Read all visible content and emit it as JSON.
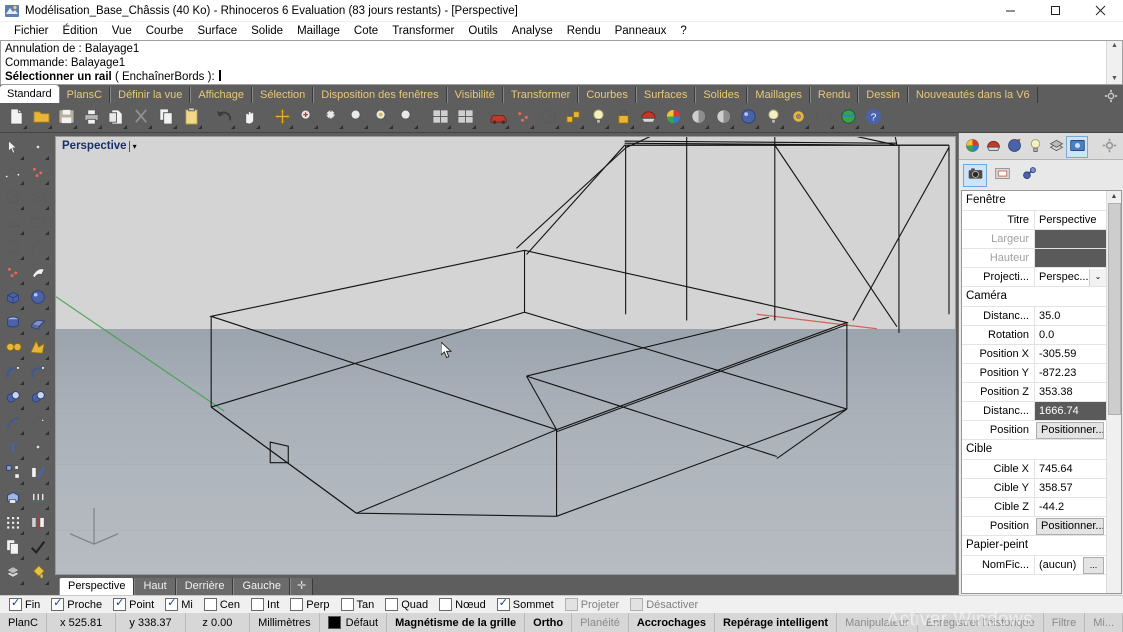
{
  "window": {
    "title": "Modélisation_Base_Châssis (40 Ko) - Rhinoceros 6 Evaluation (83 jours restants) - [Perspective]",
    "app_icon": "rhino-icon",
    "minimize": "—",
    "maximize": "▢",
    "close": "✕"
  },
  "menubar": [
    {
      "label": "Fichier",
      "name": "menu-fichier"
    },
    {
      "label": "Édition",
      "name": "menu-edition"
    },
    {
      "label": "Vue",
      "name": "menu-vue"
    },
    {
      "label": "Courbe",
      "name": "menu-courbe"
    },
    {
      "label": "Surface",
      "name": "menu-surface"
    },
    {
      "label": "Solide",
      "name": "menu-solide"
    },
    {
      "label": "Maillage",
      "name": "menu-maillage"
    },
    {
      "label": "Cote",
      "name": "menu-cote"
    },
    {
      "label": "Transformer",
      "name": "menu-transformer"
    },
    {
      "label": "Outils",
      "name": "menu-outils"
    },
    {
      "label": "Analyse",
      "name": "menu-analyse"
    },
    {
      "label": "Rendu",
      "name": "menu-rendu"
    },
    {
      "label": "Panneaux",
      "name": "menu-panneaux"
    },
    {
      "label": "?",
      "name": "menu-aide"
    }
  ],
  "command_area": {
    "history_line_1": "Annulation de : Balayage1",
    "history_line_2": "Commande: Balayage1",
    "prompt_bold": "Sélectionner un rail",
    "prompt_option": "( EnchaînerBords ):",
    "input_value": ""
  },
  "toolbar_tabs": [
    {
      "label": "Standard",
      "active": true
    },
    {
      "label": "PlansC",
      "active": false
    },
    {
      "label": "Définir la vue",
      "active": false
    },
    {
      "label": "Affichage",
      "active": false
    },
    {
      "label": "Sélection",
      "active": false
    },
    {
      "label": "Disposition des fenêtres",
      "active": false
    },
    {
      "label": "Visibilité",
      "active": false
    },
    {
      "label": "Transformer",
      "active": false
    },
    {
      "label": "Courbes",
      "active": false
    },
    {
      "label": "Surfaces",
      "active": false
    },
    {
      "label": "Solides",
      "active": false
    },
    {
      "label": "Maillages",
      "active": false
    },
    {
      "label": "Rendu",
      "active": false
    },
    {
      "label": "Dessin",
      "active": false
    },
    {
      "label": "Nouveautés dans la V6",
      "active": false
    }
  ],
  "toolbar_tabs_gear": "gear-icon",
  "main_toolbar": [
    {
      "icon": "new-file-icon"
    },
    {
      "icon": "open-folder-icon"
    },
    {
      "icon": "save-icon"
    },
    {
      "icon": "print-icon"
    },
    {
      "icon": "cut-icon"
    },
    {
      "icon": "scissors-icon"
    },
    {
      "icon": "copy-icon"
    },
    {
      "icon": "paste-icon"
    },
    {
      "icon": "undo-icon"
    },
    {
      "icon": "pan-hand-icon"
    },
    {
      "icon": "move-icon"
    },
    {
      "icon": "zoom-in-icon"
    },
    {
      "icon": "zoom-window-icon"
    },
    {
      "icon": "zoom-extents-icon"
    },
    {
      "icon": "zoom-selected-icon"
    },
    {
      "icon": "zoom-previous-icon"
    },
    {
      "icon": "viewport-4-icon"
    },
    {
      "icon": "viewport-layout-icon"
    },
    {
      "icon": "car-icon"
    },
    {
      "icon": "points-icon"
    },
    {
      "icon": "circle-point-icon"
    },
    {
      "icon": "blocks-icon"
    },
    {
      "icon": "light-bulb-icon"
    },
    {
      "icon": "lock-icon"
    },
    {
      "icon": "materials-icon"
    },
    {
      "icon": "color-wheel-icon"
    },
    {
      "icon": "shade-sphere-icon"
    },
    {
      "icon": "render-sphere-icon"
    },
    {
      "icon": "blue-sphere-icon"
    },
    {
      "icon": "spotlight-icon"
    },
    {
      "icon": "gear-orange-icon"
    },
    {
      "icon": "dimension-icon"
    },
    {
      "icon": "earth-icon"
    },
    {
      "icon": "help-icon"
    }
  ],
  "left_toolbar": [
    {
      "icon": "select-arrow-icon"
    },
    {
      "icon": "point-icon"
    },
    {
      "icon": "polyline-icon"
    },
    {
      "icon": "curve-control-points-icon"
    },
    {
      "icon": "circle-icon"
    },
    {
      "icon": "ellipse-icon"
    },
    {
      "icon": "arc-icon"
    },
    {
      "icon": "rectangle-icon"
    },
    {
      "icon": "polygon-icon"
    },
    {
      "icon": "free-curve-icon"
    },
    {
      "icon": "surface-control-points-icon"
    },
    {
      "icon": "revolve-surface-icon"
    },
    {
      "icon": "box-icon"
    },
    {
      "icon": "sphere-icon"
    },
    {
      "icon": "cylinder-icon"
    },
    {
      "icon": "extrude-surface-icon"
    },
    {
      "icon": "boolean-union-icon"
    },
    {
      "icon": "boolean-split-icon"
    },
    {
      "icon": "fillet-edge-icon"
    },
    {
      "icon": "chamfer-edge-icon"
    },
    {
      "icon": "boolean-difference-icon"
    },
    {
      "icon": "boolean-intersection-icon"
    },
    {
      "icon": "offset-curve-icon"
    },
    {
      "icon": "blend-curve-icon"
    },
    {
      "icon": "text-icon"
    },
    {
      "icon": "point-editing-icon"
    },
    {
      "icon": "explode-icon"
    },
    {
      "icon": "trim-icon"
    },
    {
      "icon": "cap-planar-icon"
    },
    {
      "icon": "array-linear-icon"
    },
    {
      "icon": "array-grid-icon"
    },
    {
      "icon": "mirror-icon"
    },
    {
      "icon": "copy-object-icon"
    },
    {
      "icon": "check-icon"
    },
    {
      "icon": "layers-icon"
    },
    {
      "icon": "paint-bucket-icon"
    }
  ],
  "viewport": {
    "title": "Perspective",
    "dropdown_arrow": "▾",
    "cursor_label": "mouse-pointer",
    "sky_color": "#d4d4d4",
    "ground_color": "#a8afb8",
    "wire_color": "#000000",
    "x_axis_color": "#c94b3a",
    "y_axis_color": "#3fa24a",
    "tabs": [
      {
        "label": "Perspective",
        "active": true
      },
      {
        "label": "Haut",
        "active": false
      },
      {
        "label": "Derrière",
        "active": false
      },
      {
        "label": "Gauche",
        "active": false
      }
    ],
    "tab_add": "✛"
  },
  "right_panel": {
    "panel_icons": [
      {
        "icon": "properties-icon",
        "selected": false
      },
      {
        "icon": "materials-icon",
        "selected": false
      },
      {
        "icon": "render-icon",
        "selected": false
      },
      {
        "icon": "light-icon",
        "selected": false
      },
      {
        "icon": "layers-folder-icon",
        "selected": false
      },
      {
        "icon": "display-icon",
        "selected": true
      },
      {
        "icon": "gear-icon",
        "selected": false
      }
    ],
    "sub_icons": [
      {
        "icon": "camera-icon",
        "selected": true
      },
      {
        "icon": "viewport-frame-icon",
        "selected": false
      },
      {
        "icon": "object-props-icon",
        "selected": false
      }
    ],
    "sections": [
      {
        "name": "Fenêtre",
        "title": "Fenêtre",
        "rows": [
          {
            "label": "Titre",
            "value": "Perspective",
            "kind": "text"
          },
          {
            "label": "Largeur",
            "value": "",
            "kind": "gray",
            "dim": true
          },
          {
            "label": "Hauteur",
            "value": "",
            "kind": "gray",
            "dim": true
          },
          {
            "label": "Projecti...",
            "value": "Perspec...",
            "kind": "combo",
            "arrow": "⌄"
          }
        ]
      },
      {
        "name": "Caméra",
        "title": "Caméra",
        "rows": [
          {
            "label": "Distanc...",
            "value": "35.0",
            "kind": "text"
          },
          {
            "label": "Rotation",
            "value": "0.0",
            "kind": "text"
          },
          {
            "label": "Position X",
            "value": "-305.59",
            "kind": "text"
          },
          {
            "label": "Position Y",
            "value": "-872.23",
            "kind": "text"
          },
          {
            "label": "Position Z",
            "value": "353.38",
            "kind": "text"
          },
          {
            "label": "Distanc...",
            "value": "1666.74",
            "kind": "selected"
          },
          {
            "label": "Position",
            "value": "Positionner...",
            "kind": "button"
          }
        ]
      },
      {
        "name": "Cible",
        "title": "Cible",
        "rows": [
          {
            "label": "Cible X",
            "value": "745.64",
            "kind": "text"
          },
          {
            "label": "Cible Y",
            "value": "358.57",
            "kind": "text"
          },
          {
            "label": "Cible Z",
            "value": "-44.2",
            "kind": "text"
          },
          {
            "label": "Position",
            "value": "Positionner...",
            "kind": "button"
          }
        ]
      },
      {
        "name": "Papier-peint",
        "title": "Papier-peint",
        "rows": [
          {
            "label": "NomFic...",
            "value": "(aucun)",
            "kind": "file",
            "file_btn": "..."
          }
        ]
      }
    ],
    "scroll_up": "⌃",
    "scroll_down": "⌄"
  },
  "osnap": [
    {
      "label": "Fin",
      "checked": true,
      "enabled": true
    },
    {
      "label": "Proche",
      "checked": true,
      "enabled": true
    },
    {
      "label": "Point",
      "checked": true,
      "enabled": true
    },
    {
      "label": "Mi",
      "checked": true,
      "enabled": true
    },
    {
      "label": "Cen",
      "checked": false,
      "enabled": true
    },
    {
      "label": "Int",
      "checked": false,
      "enabled": true
    },
    {
      "label": "Perp",
      "checked": false,
      "enabled": true
    },
    {
      "label": "Tan",
      "checked": false,
      "enabled": true
    },
    {
      "label": "Quad",
      "checked": false,
      "enabled": true
    },
    {
      "label": "Nœud",
      "checked": false,
      "enabled": true
    },
    {
      "label": "Sommet",
      "checked": true,
      "enabled": true
    },
    {
      "label": "Projeter",
      "checked": false,
      "enabled": false
    },
    {
      "label": "Désactiver",
      "checked": false,
      "enabled": false
    }
  ],
  "statusbar": {
    "cplane": "PlanC",
    "x": "x 525.81",
    "y": "y 338.37",
    "z": "z 0.00",
    "units": "Millimètres",
    "layer": "Défaut",
    "layer_color": "#000000",
    "toggles": [
      {
        "label": "Magnétisme de la grille",
        "on": true
      },
      {
        "label": "Ortho",
        "on": true
      },
      {
        "label": "Planéité",
        "on": false
      },
      {
        "label": "Accrochages",
        "on": true
      },
      {
        "label": "Repérage intelligent",
        "on": true
      },
      {
        "label": "Manipulateur",
        "on": false
      },
      {
        "label": "Enregistrer l'historique",
        "on": false
      },
      {
        "label": "Filtre",
        "on": false
      },
      {
        "label": "Mi...",
        "on": false
      }
    ]
  },
  "watermark": "Activer Windows"
}
